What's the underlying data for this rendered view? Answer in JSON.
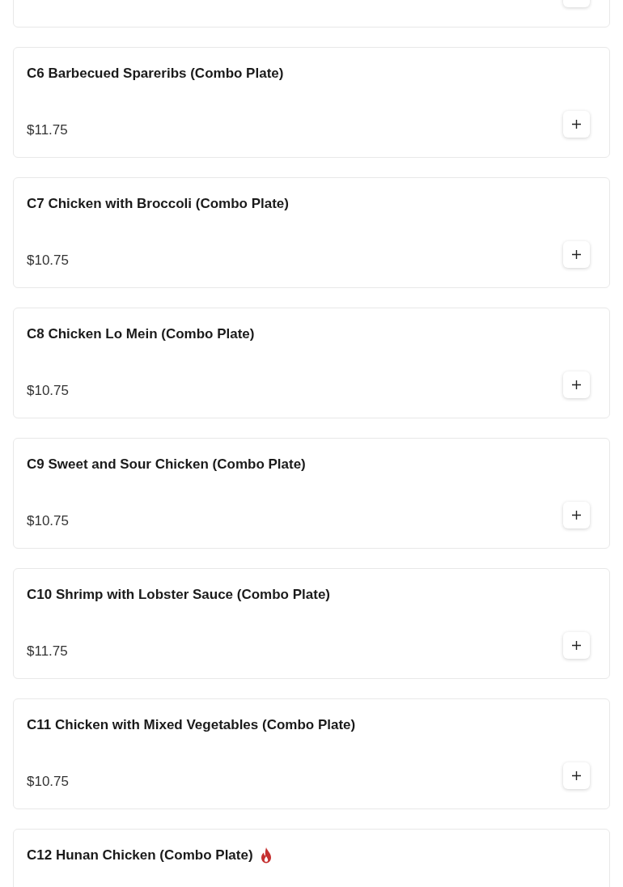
{
  "items": [
    {
      "spicy": false
    },
    {
      "title": "C6 Barbecued Spareribs (Combo Plate)",
      "price": "$11.75",
      "spicy": false
    },
    {
      "title": "C7 Chicken with Broccoli (Combo Plate)",
      "price": "$10.75",
      "spicy": false
    },
    {
      "title": "C8 Chicken Lo Mein (Combo Plate)",
      "price": "$10.75",
      "spicy": false
    },
    {
      "title": "C9 Sweet and Sour Chicken (Combo Plate)",
      "price": "$10.75",
      "spicy": false
    },
    {
      "title": "C10 Shrimp with Lobster Sauce (Combo Plate)",
      "price": "$11.75",
      "spicy": false
    },
    {
      "title": "C11 Chicken with Mixed Vegetables (Combo Plate)",
      "price": "$10.75",
      "spicy": false
    },
    {
      "title": "C12 Hunan Chicken (Combo Plate)",
      "spicy": true
    }
  ]
}
